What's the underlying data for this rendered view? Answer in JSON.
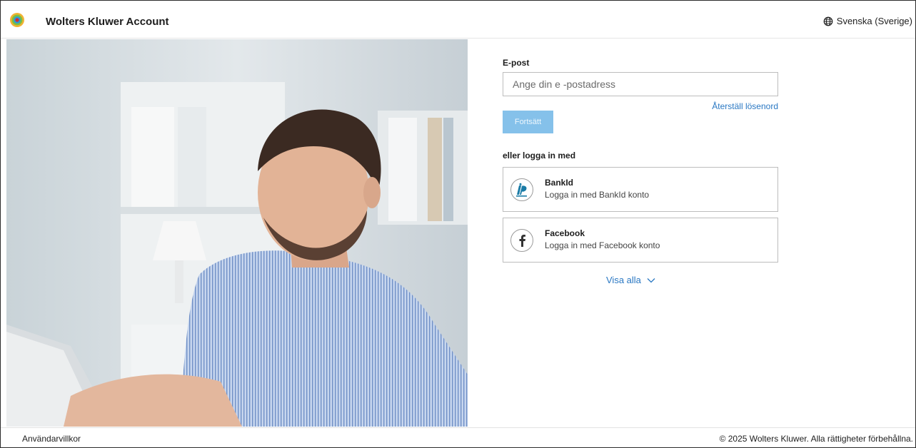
{
  "header": {
    "brand": "Wolters Kluwer Account",
    "language": "Svenska (Sverige)",
    "logo_icon": "wolters-kluwer-logo",
    "language_icon": "globe-icon"
  },
  "hero": {
    "description_icon": "photo-man-at-laptop"
  },
  "form": {
    "email_label": "E-post",
    "email_placeholder": "Ange din e -postadress",
    "email_value": "",
    "reset_link": "Återställ lösenord",
    "continue_label": "Fortsätt",
    "or_label": "eller logga in med",
    "providers": [
      {
        "title": "BankId",
        "subtitle": "Logga in med BankId konto",
        "icon": "bankid-icon"
      },
      {
        "title": "Facebook",
        "subtitle": "Logga in med Facebook konto",
        "icon": "facebook-icon"
      }
    ],
    "show_all": "Visa alla"
  },
  "footer": {
    "terms": "Användarvillkor",
    "copyright": "© 2025 Wolters Kluwer. Alla rättigheter förbehållna."
  },
  "colors": {
    "link": "#2a78c3",
    "button": "#85c1ea"
  }
}
